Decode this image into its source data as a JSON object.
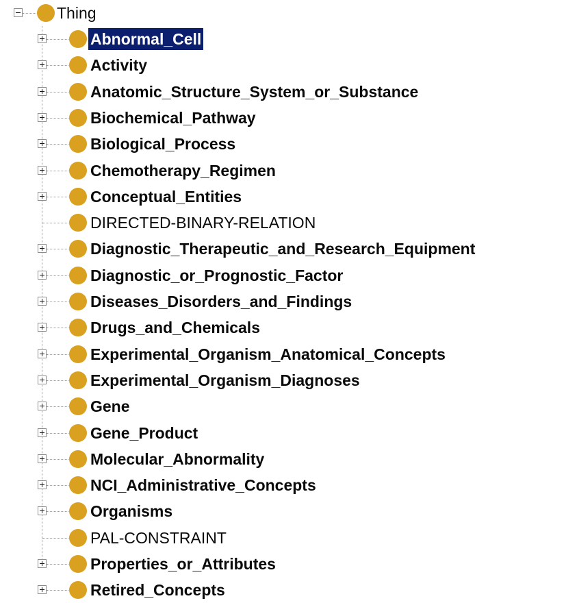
{
  "root": {
    "label": "Thing",
    "expanded": true
  },
  "items": [
    {
      "label": "Abnormal_Cell",
      "bold": true,
      "expandable": true,
      "selected": true
    },
    {
      "label": "Activity",
      "bold": true,
      "expandable": true
    },
    {
      "label": "Anatomic_Structure_System_or_Substance",
      "bold": true,
      "expandable": true
    },
    {
      "label": "Biochemical_Pathway",
      "bold": true,
      "expandable": true
    },
    {
      "label": "Biological_Process",
      "bold": true,
      "expandable": true
    },
    {
      "label": "Chemotherapy_Regimen",
      "bold": true,
      "expandable": true
    },
    {
      "label": "Conceptual_Entities",
      "bold": true,
      "expandable": true
    },
    {
      "label": "DIRECTED-BINARY-RELATION",
      "bold": false,
      "expandable": false
    },
    {
      "label": "Diagnostic_Therapeutic_and_Research_Equipment",
      "bold": true,
      "expandable": true
    },
    {
      "label": "Diagnostic_or_Prognostic_Factor",
      "bold": true,
      "expandable": true
    },
    {
      "label": "Diseases_Disorders_and_Findings",
      "bold": true,
      "expandable": true
    },
    {
      "label": "Drugs_and_Chemicals",
      "bold": true,
      "expandable": true
    },
    {
      "label": "Experimental_Organism_Anatomical_Concepts",
      "bold": true,
      "expandable": true
    },
    {
      "label": "Experimental_Organism_Diagnoses",
      "bold": true,
      "expandable": true
    },
    {
      "label": "Gene",
      "bold": true,
      "expandable": true
    },
    {
      "label": "Gene_Product",
      "bold": true,
      "expandable": true
    },
    {
      "label": "Molecular_Abnormality",
      "bold": true,
      "expandable": true
    },
    {
      "label": "NCI_Administrative_Concepts",
      "bold": true,
      "expandable": true
    },
    {
      "label": "Organisms",
      "bold": true,
      "expandable": true
    },
    {
      "label": "PAL-CONSTRAINT",
      "bold": false,
      "expandable": false
    },
    {
      "label": "Properties_or_Attributes",
      "bold": true,
      "expandable": true
    },
    {
      "label": "Retired_Concepts",
      "bold": true,
      "expandable": true
    }
  ],
  "colors": {
    "class_ball": "#d9a11f",
    "selection_bg": "#0b1f6e",
    "selection_text": "#ffffff",
    "text": "#0a0a0a"
  }
}
